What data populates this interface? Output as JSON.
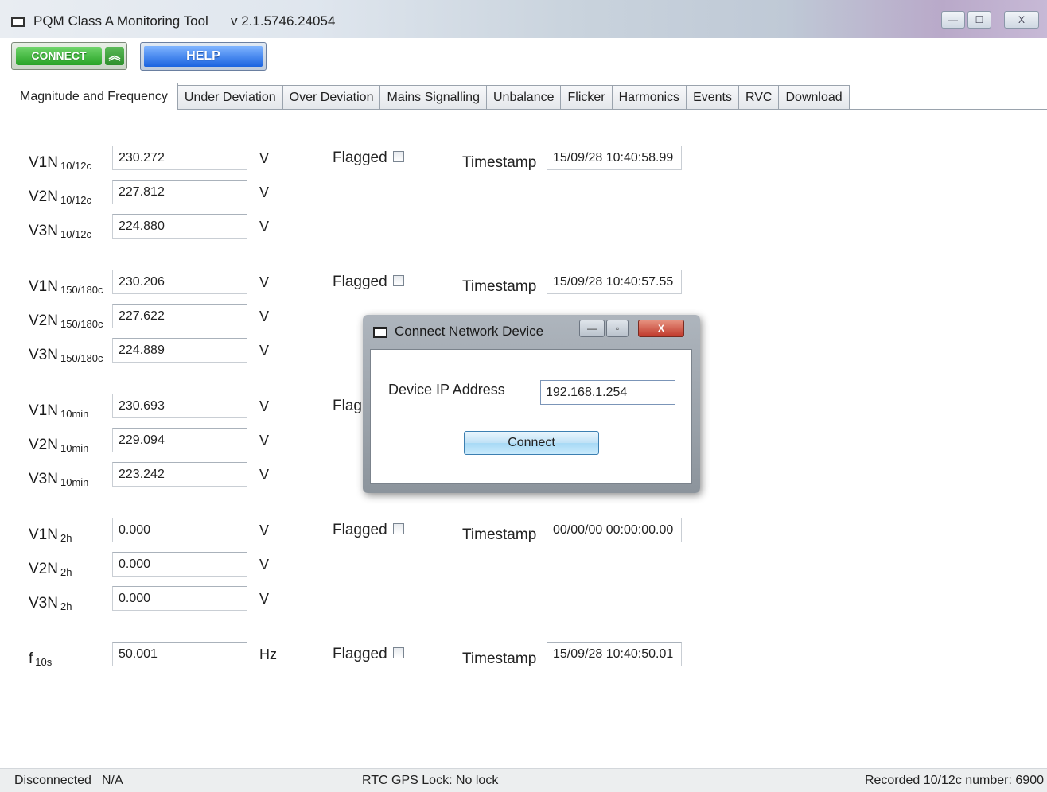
{
  "window": {
    "title": "PQM Class A Monitoring Tool",
    "version": "v 2.1.5746.24054",
    "minimize": "—",
    "maximize": "☐",
    "close": "X"
  },
  "toolbar": {
    "connect_label": "CONNECT",
    "connect_chevron": "︽",
    "help_label": "HELP"
  },
  "tabs": [
    {
      "label": "Magnitude and Frequency",
      "active": true
    },
    {
      "label": "Under Deviation"
    },
    {
      "label": "Over Deviation"
    },
    {
      "label": "Mains Signalling"
    },
    {
      "label": "Unbalance"
    },
    {
      "label": "Flicker"
    },
    {
      "label": "Harmonics"
    },
    {
      "label": "Events"
    },
    {
      "label": "RVC"
    },
    {
      "label": "Download"
    }
  ],
  "groups": [
    {
      "rows": [
        {
          "label": "V1N",
          "sub": "10/12c",
          "value": "230.272",
          "unit": "V"
        },
        {
          "label": "V2N",
          "sub": "10/12c",
          "value": "227.812",
          "unit": "V"
        },
        {
          "label": "V3N",
          "sub": "10/12c",
          "value": "224.880",
          "unit": "V"
        }
      ],
      "flagged_label": "Flagged",
      "timestamp_label": "Timestamp",
      "timestamp": "15/09/28 10:40:58.99"
    },
    {
      "rows": [
        {
          "label": "V1N",
          "sub": "150/180c",
          "value": "230.206",
          "unit": "V"
        },
        {
          "label": "V2N",
          "sub": "150/180c",
          "value": "227.622",
          "unit": "V"
        },
        {
          "label": "V3N",
          "sub": "150/180c",
          "value": "224.889",
          "unit": "V"
        }
      ],
      "flagged_label": "Flagged",
      "timestamp_label": "Timestamp",
      "timestamp": "15/09/28 10:40:57.55"
    },
    {
      "rows": [
        {
          "label": "V1N",
          "sub": "10min",
          "value": "230.693",
          "unit": "V"
        },
        {
          "label": "V2N",
          "sub": "10min",
          "value": "229.094",
          "unit": "V"
        },
        {
          "label": "V3N",
          "sub": "10min",
          "value": "223.242",
          "unit": "V"
        }
      ],
      "flagged_label": "Flag",
      "timestamp_label": "",
      "timestamp": ""
    },
    {
      "rows": [
        {
          "label": "V1N",
          "sub": "2h",
          "value": "0.000",
          "unit": "V"
        },
        {
          "label": "V2N",
          "sub": "2h",
          "value": "0.000",
          "unit": "V"
        },
        {
          "label": "V3N",
          "sub": "2h",
          "value": "0.000",
          "unit": "V"
        }
      ],
      "flagged_label": "Flagged",
      "timestamp_label": "Timestamp",
      "timestamp": "00/00/00 00:00:00.00"
    },
    {
      "rows": [
        {
          "label": "f",
          "sub": "10s",
          "value": "50.001",
          "unit": "Hz"
        }
      ],
      "flagged_label": "Flagged",
      "timestamp_label": "Timestamp",
      "timestamp": "15/09/28 10:40:50.01"
    }
  ],
  "dialog": {
    "title": "Connect Network Device",
    "ip_label": "Device IP Address",
    "ip_value": "192.168.1.254",
    "connect_label": "Connect",
    "minimize": "—",
    "maximize": "▫",
    "close": "X"
  },
  "statusbar": {
    "connection": "Disconnected",
    "connection_detail": "N/A",
    "gps": "RTC GPS Lock:  No lock",
    "recorded": "Recorded 10/12c number:  6900"
  }
}
